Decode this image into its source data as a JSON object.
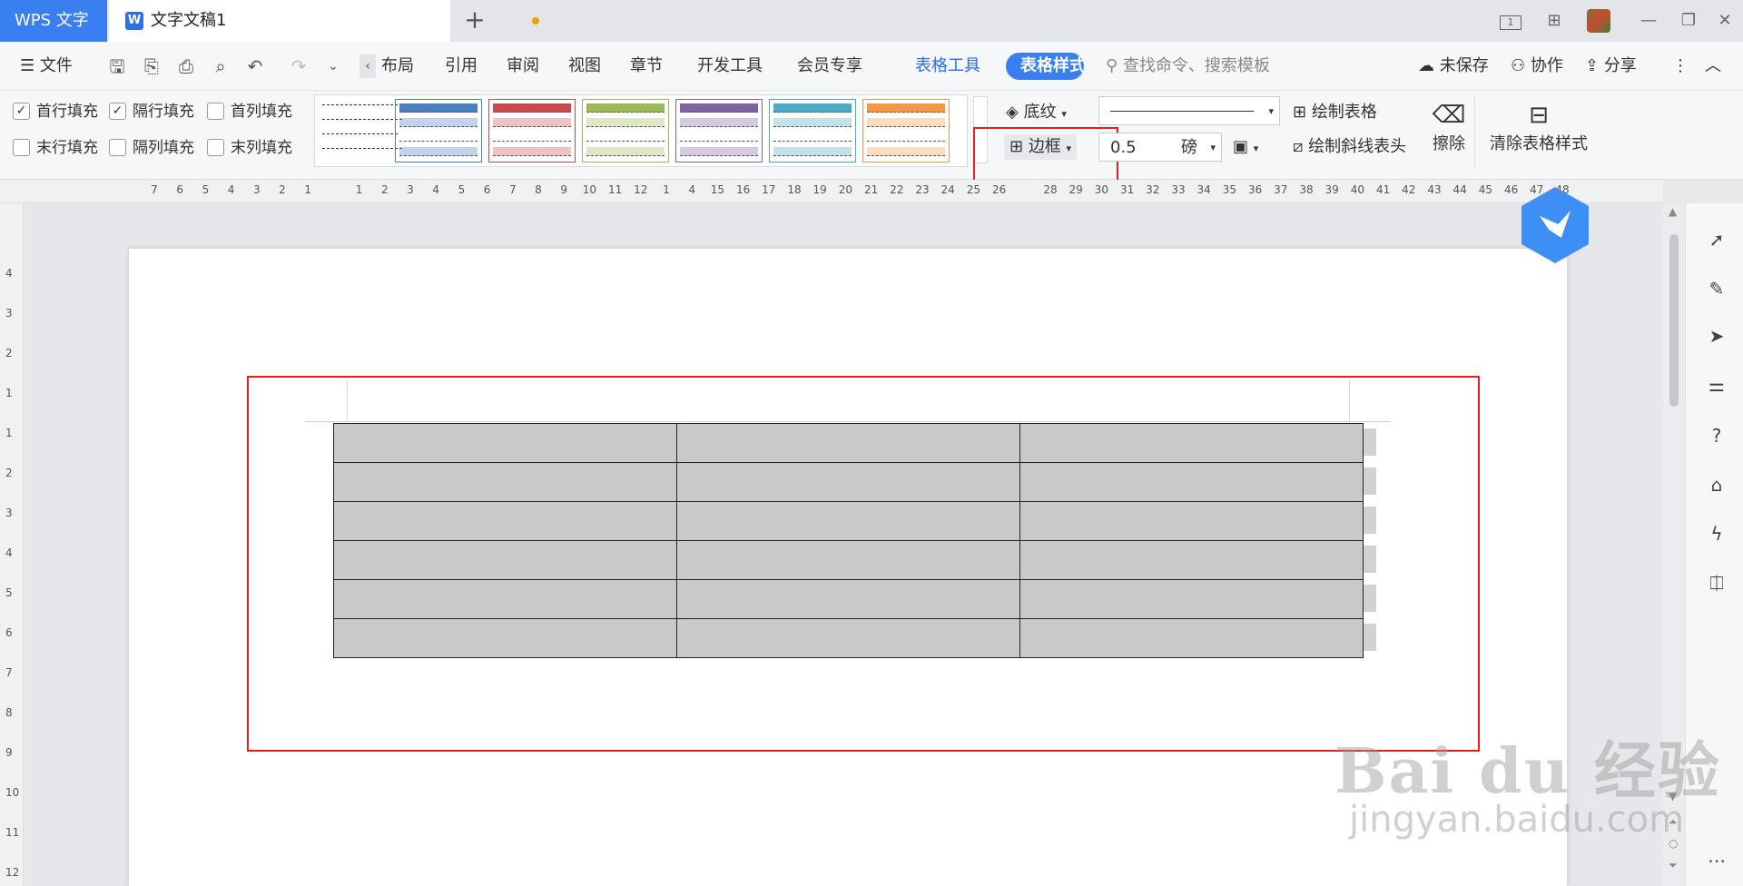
{
  "titlebar": {
    "app_tab": "WPS 文字",
    "doc_tab": "文字文稿1",
    "doc_icon": "W",
    "page_indicator": "1"
  },
  "menubar": {
    "file": "文件",
    "layout": "布局",
    "reference": "引用",
    "review": "审阅",
    "view": "视图",
    "chapter": "章节",
    "devtools": "开发工具",
    "member": "会员专享",
    "table_tools": "表格工具",
    "table_style": "表格样式",
    "search_placeholder": "查找命令、搜索模板",
    "unsaved": "未保存",
    "collab": "协作",
    "share": "分享"
  },
  "ribbon": {
    "first_row_fill": "首行填充",
    "alt_row_fill": "隔行填充",
    "first_col_fill": "首列填充",
    "last_row_fill": "末行填充",
    "alt_col_fill": "隔列填充",
    "last_col_fill": "末列填充",
    "shading": "底纹",
    "border": "边框",
    "line_width": "0.5",
    "line_unit": "磅",
    "draw_table": "绘制表格",
    "draw_diagonal": "绘制斜线表头",
    "erase": "擦除",
    "clear_style": "清除表格样式",
    "checks": {
      "first_row": true,
      "alt_row": true,
      "first_col": false,
      "last_row": false,
      "alt_col": false,
      "last_col": false
    },
    "style_colors": [
      "#4a7fc1",
      "#c94b4b",
      "#9bbb59",
      "#8064a2",
      "#4bacc6",
      "#f79646"
    ]
  },
  "ruler": {
    "numbers": [
      "7",
      "6",
      "5",
      "4",
      "3",
      "2",
      "1",
      "",
      "1",
      "2",
      "3",
      "4",
      "5",
      "6",
      "7",
      "8",
      "9",
      "10",
      "11",
      "12",
      "1",
      "4",
      "15",
      "16",
      "17",
      "18",
      "19",
      "20",
      "21",
      "22",
      "23",
      "24",
      "25",
      "26",
      "",
      "28",
      "29",
      "30",
      "31",
      "32",
      "33",
      "34",
      "35",
      "36",
      "37",
      "38",
      "39",
      "40",
      "41",
      "42",
      "43",
      "44",
      "45",
      "46",
      "47",
      "48"
    ],
    "vertical": [
      "4",
      "3",
      "2",
      "1",
      "1",
      "2",
      "3",
      "4",
      "5",
      "6",
      "7",
      "8",
      "9",
      "10",
      "11",
      "12"
    ]
  },
  "table": {
    "rows": 6,
    "cols": 3
  },
  "watermark": {
    "logo": "Bai du 经验",
    "url": "jingyan.baidu.com"
  }
}
